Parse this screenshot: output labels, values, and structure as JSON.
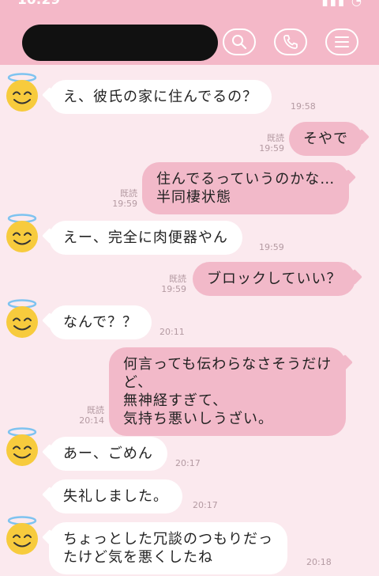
{
  "status_bar": {
    "time": "10:29",
    "icons": "▮▮▮ ◔"
  },
  "header": {
    "contact_name": "",
    "buttons": [
      "search-icon",
      "phone-icon",
      "menu-icon"
    ]
  },
  "messages": [
    {
      "side": "in",
      "text": "え、彼氏の家に住んでるの？",
      "time": "19:58",
      "avatar": true
    },
    {
      "side": "out",
      "text": "そやで",
      "read": "既読",
      "time": "19:59"
    },
    {
      "side": "out",
      "lines": [
        "住んでるっていうのかな…",
        "半同棲状態"
      ],
      "read": "既読",
      "time": "19:59"
    },
    {
      "side": "in",
      "text": "えー、完全に肉便器やん",
      "time": "19:59",
      "avatar": true
    },
    {
      "side": "out",
      "text": "ブロックしていい？",
      "read": "既読",
      "time": "19:59"
    },
    {
      "side": "in",
      "text": "なんで？？",
      "time": "20:11",
      "avatar": true
    },
    {
      "side": "out",
      "lines": [
        "何言っても伝わらなさそうだけ",
        "ど、",
        "無神経すぎて、",
        "気持ち悪いしうざい。"
      ],
      "read": "既読",
      "time": "20:14"
    },
    {
      "side": "in",
      "text": "あー、ごめん",
      "time": "20:17",
      "avatar": true
    },
    {
      "side": "in",
      "text": "失礼しました。",
      "time": "20:17",
      "avatar": false
    },
    {
      "side": "in",
      "lines": [
        "ちょっとした冗談のつもりだっ",
        "たけど気を悪くしたね"
      ],
      "time": "20:18",
      "avatar": true
    }
  ],
  "colors": {
    "header": "#f4b8c8",
    "background": "#fbe9ee",
    "outgoing": "#f2b9c9",
    "incoming": "#ffffff",
    "meta": "#b49aa2"
  }
}
